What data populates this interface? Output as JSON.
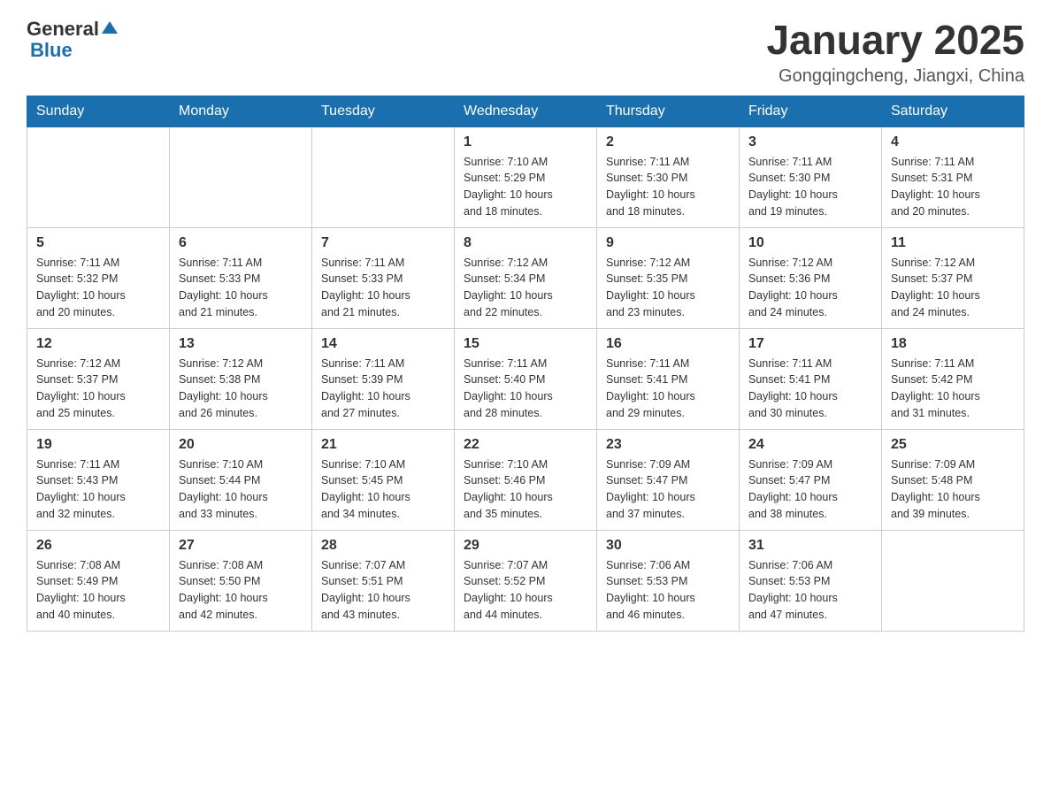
{
  "header": {
    "logo_general": "General",
    "logo_blue": "Blue",
    "title": "January 2025",
    "subtitle": "Gongqingcheng, Jiangxi, China"
  },
  "days": [
    "Sunday",
    "Monday",
    "Tuesday",
    "Wednesday",
    "Thursday",
    "Friday",
    "Saturday"
  ],
  "weeks": [
    {
      "cells": [
        {
          "date": "",
          "info": ""
        },
        {
          "date": "",
          "info": ""
        },
        {
          "date": "",
          "info": ""
        },
        {
          "date": "1",
          "info": "Sunrise: 7:10 AM\nSunset: 5:29 PM\nDaylight: 10 hours\nand 18 minutes."
        },
        {
          "date": "2",
          "info": "Sunrise: 7:11 AM\nSunset: 5:30 PM\nDaylight: 10 hours\nand 18 minutes."
        },
        {
          "date": "3",
          "info": "Sunrise: 7:11 AM\nSunset: 5:30 PM\nDaylight: 10 hours\nand 19 minutes."
        },
        {
          "date": "4",
          "info": "Sunrise: 7:11 AM\nSunset: 5:31 PM\nDaylight: 10 hours\nand 20 minutes."
        }
      ]
    },
    {
      "cells": [
        {
          "date": "5",
          "info": "Sunrise: 7:11 AM\nSunset: 5:32 PM\nDaylight: 10 hours\nand 20 minutes."
        },
        {
          "date": "6",
          "info": "Sunrise: 7:11 AM\nSunset: 5:33 PM\nDaylight: 10 hours\nand 21 minutes."
        },
        {
          "date": "7",
          "info": "Sunrise: 7:11 AM\nSunset: 5:33 PM\nDaylight: 10 hours\nand 21 minutes."
        },
        {
          "date": "8",
          "info": "Sunrise: 7:12 AM\nSunset: 5:34 PM\nDaylight: 10 hours\nand 22 minutes."
        },
        {
          "date": "9",
          "info": "Sunrise: 7:12 AM\nSunset: 5:35 PM\nDaylight: 10 hours\nand 23 minutes."
        },
        {
          "date": "10",
          "info": "Sunrise: 7:12 AM\nSunset: 5:36 PM\nDaylight: 10 hours\nand 24 minutes."
        },
        {
          "date": "11",
          "info": "Sunrise: 7:12 AM\nSunset: 5:37 PM\nDaylight: 10 hours\nand 24 minutes."
        }
      ]
    },
    {
      "cells": [
        {
          "date": "12",
          "info": "Sunrise: 7:12 AM\nSunset: 5:37 PM\nDaylight: 10 hours\nand 25 minutes."
        },
        {
          "date": "13",
          "info": "Sunrise: 7:12 AM\nSunset: 5:38 PM\nDaylight: 10 hours\nand 26 minutes."
        },
        {
          "date": "14",
          "info": "Sunrise: 7:11 AM\nSunset: 5:39 PM\nDaylight: 10 hours\nand 27 minutes."
        },
        {
          "date": "15",
          "info": "Sunrise: 7:11 AM\nSunset: 5:40 PM\nDaylight: 10 hours\nand 28 minutes."
        },
        {
          "date": "16",
          "info": "Sunrise: 7:11 AM\nSunset: 5:41 PM\nDaylight: 10 hours\nand 29 minutes."
        },
        {
          "date": "17",
          "info": "Sunrise: 7:11 AM\nSunset: 5:41 PM\nDaylight: 10 hours\nand 30 minutes."
        },
        {
          "date": "18",
          "info": "Sunrise: 7:11 AM\nSunset: 5:42 PM\nDaylight: 10 hours\nand 31 minutes."
        }
      ]
    },
    {
      "cells": [
        {
          "date": "19",
          "info": "Sunrise: 7:11 AM\nSunset: 5:43 PM\nDaylight: 10 hours\nand 32 minutes."
        },
        {
          "date": "20",
          "info": "Sunrise: 7:10 AM\nSunset: 5:44 PM\nDaylight: 10 hours\nand 33 minutes."
        },
        {
          "date": "21",
          "info": "Sunrise: 7:10 AM\nSunset: 5:45 PM\nDaylight: 10 hours\nand 34 minutes."
        },
        {
          "date": "22",
          "info": "Sunrise: 7:10 AM\nSunset: 5:46 PM\nDaylight: 10 hours\nand 35 minutes."
        },
        {
          "date": "23",
          "info": "Sunrise: 7:09 AM\nSunset: 5:47 PM\nDaylight: 10 hours\nand 37 minutes."
        },
        {
          "date": "24",
          "info": "Sunrise: 7:09 AM\nSunset: 5:47 PM\nDaylight: 10 hours\nand 38 minutes."
        },
        {
          "date": "25",
          "info": "Sunrise: 7:09 AM\nSunset: 5:48 PM\nDaylight: 10 hours\nand 39 minutes."
        }
      ]
    },
    {
      "cells": [
        {
          "date": "26",
          "info": "Sunrise: 7:08 AM\nSunset: 5:49 PM\nDaylight: 10 hours\nand 40 minutes."
        },
        {
          "date": "27",
          "info": "Sunrise: 7:08 AM\nSunset: 5:50 PM\nDaylight: 10 hours\nand 42 minutes."
        },
        {
          "date": "28",
          "info": "Sunrise: 7:07 AM\nSunset: 5:51 PM\nDaylight: 10 hours\nand 43 minutes."
        },
        {
          "date": "29",
          "info": "Sunrise: 7:07 AM\nSunset: 5:52 PM\nDaylight: 10 hours\nand 44 minutes."
        },
        {
          "date": "30",
          "info": "Sunrise: 7:06 AM\nSunset: 5:53 PM\nDaylight: 10 hours\nand 46 minutes."
        },
        {
          "date": "31",
          "info": "Sunrise: 7:06 AM\nSunset: 5:53 PM\nDaylight: 10 hours\nand 47 minutes."
        },
        {
          "date": "",
          "info": ""
        }
      ]
    }
  ]
}
